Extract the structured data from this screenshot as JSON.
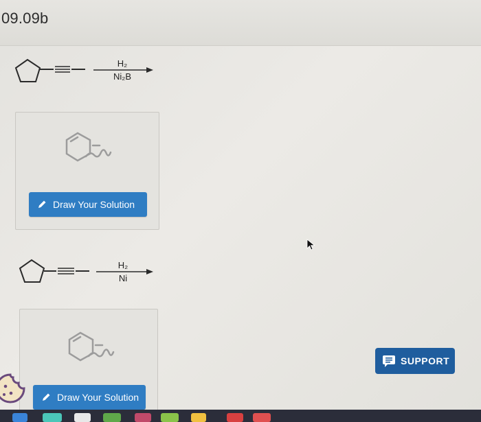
{
  "header": {
    "title": "09.09b"
  },
  "reactions": [
    {
      "reagent_top": "H₂",
      "reagent_bottom": "Ni₂B",
      "button_label": "Draw Your Solution"
    },
    {
      "reagent_top": "H₂",
      "reagent_bottom": "Ni",
      "button_label": "Draw Your Solution"
    }
  ],
  "support": {
    "label": "SUPPORT"
  },
  "colors": {
    "button_blue": "#2f7dc3",
    "support_blue": "#1f5d9e"
  },
  "icons": [
    "pencil-icon",
    "chat-icon",
    "cookie-icon",
    "cursor-arrow-icon",
    "chemistry-sketch-icon"
  ]
}
